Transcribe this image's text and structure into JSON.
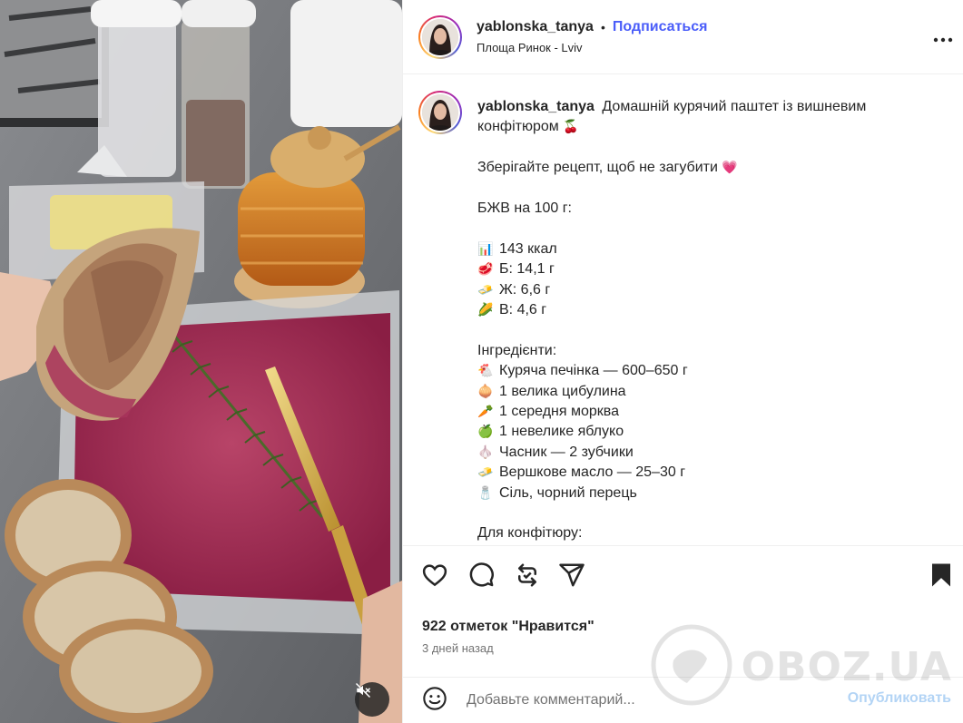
{
  "post": {
    "username": "yablonska_tanya",
    "follow_label": "Подписаться",
    "separator": "•",
    "location": "Площа Ринок - Lviv",
    "more_icon": "more-horizontal-icon"
  },
  "caption": {
    "username": "yablonska_tanya",
    "title": "Домашній курячий паштет із вишневим конфітюром",
    "title_emoji": "🍒",
    "save_text": "Зберігайте рецепт, щоб не загубити",
    "save_emoji": "💗",
    "nutrition_header": "БЖВ на 100 г:",
    "nutrition": [
      {
        "emoji": "📊",
        "text": "143 ккал"
      },
      {
        "emoji": "🥩",
        "text": "Б: 14,1 г"
      },
      {
        "emoji": "🧈",
        "text": "Ж: 6,6 г"
      },
      {
        "emoji": "🌽",
        "text": "В: 4,6 г"
      }
    ],
    "ingredients_header": "Інгредієнти:",
    "ingredients": [
      {
        "emoji": "🐔",
        "text": "Куряча печінка — 600–650 г"
      },
      {
        "emoji": "🧅",
        "text": "1 велика цибулина"
      },
      {
        "emoji": "🥕",
        "text": "1 середня морква"
      },
      {
        "emoji": "🍏",
        "text": "1 невелике яблуко"
      },
      {
        "emoji": "🧄",
        "text": "Часник — 2 зубчики"
      },
      {
        "emoji": "🧈",
        "text": "Вершкове масло — 25–30 г"
      },
      {
        "emoji": "🧂",
        "text": "Сіль, чорний перець"
      }
    ],
    "jam_header": "Для конфітюру:"
  },
  "actions": {
    "likes": "922 отметок \"Нравится\"",
    "time_ago": "3 дней назад",
    "icons": [
      "heart-icon",
      "comment-icon",
      "repost-icon",
      "share-icon",
      "bookmark-icon"
    ]
  },
  "comment": {
    "placeholder": "Добавьте комментарий...",
    "publish_label": "Опубликовать",
    "emoji_icon": "smiley-icon"
  },
  "watermark": {
    "text": "OBOZ.UA"
  },
  "colors": {
    "accent": "#4a5df9",
    "publish_disabled": "#b3d4f5",
    "text": "#262626",
    "muted": "#737373",
    "border": "#efefef"
  }
}
